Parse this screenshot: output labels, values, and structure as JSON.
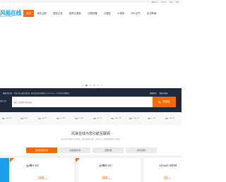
{
  "topbar": {
    "items": [
      "客服中心",
      "会员中心",
      "登录",
      "注册"
    ]
  },
  "logo": {
    "main": "风易在线",
    "sub": "FENGYIZX.NET"
  },
  "nav": {
    "items": [
      "首页",
      "域名注册",
      "虚拟主机",
      "独享云虚拟",
      "云服务器",
      "云建站",
      "小程序",
      "SSL证书",
      "企业邮局"
    ]
  },
  "banner": {
    "dots": 6,
    "active_dot": 2
  },
  "search": {
    "notice_label": "风易在线公告：",
    "notice_text": "风易在线云服务器升级，购买请咨询在线客服 (QQ:9503xxx) 【1小时内开通服务】",
    "left_label": "域名注册",
    "placeholder": "请输入您想要注册的域名",
    "button_label": "查域名",
    "right_links": [
      "批量查询",
      "域名价格表"
    ]
  },
  "prices": [
    {
      "suffix": ".com",
      "price": "55"
    },
    {
      "suffix": ".top",
      "price": "9"
    },
    {
      "suffix": ".vip",
      "price": "35"
    },
    {
      "suffix": ".cn",
      "price": "29"
    },
    {
      "suffix": ".net",
      "price": "69"
    },
    {
      "suffix": ".xyz",
      "price": "12"
    },
    {
      "suffix": ".shop",
      "price": "39"
    },
    {
      "suffix": ".wang",
      "price": "29"
    },
    {
      "suffix": ".cc",
      "price": "49"
    },
    {
      "suffix": ".club",
      "price": "35"
    }
  ],
  "section": {
    "title": "风易在线为您引航互联网",
    "subtitle": "四川风易在线旗下官方网站，为您提供域名注册、虚拟主机、云服务器等优质产品服务"
  },
  "tabs": [
    {
      "label": "国内精选服务器",
      "active": true
    },
    {
      "label": "免备案服务器",
      "active": false
    },
    {
      "label": "云服务器",
      "active": false
    },
    {
      "label": "高防云服务",
      "active": false
    }
  ],
  "cards": [
    {
      "name": "云峰A 1G",
      "price": "188",
      "unit": "元/年"
    },
    {
      "name": "云峰B 2G",
      "price": "288",
      "unit": "元/年"
    },
    {
      "name": "LinuxA 300M",
      "price": "99",
      "unit": "元/年"
    }
  ],
  "colors": {
    "accent": "#ff6a00",
    "brand": "#1aa0e8",
    "dark_bg": "#1e2a3a"
  }
}
